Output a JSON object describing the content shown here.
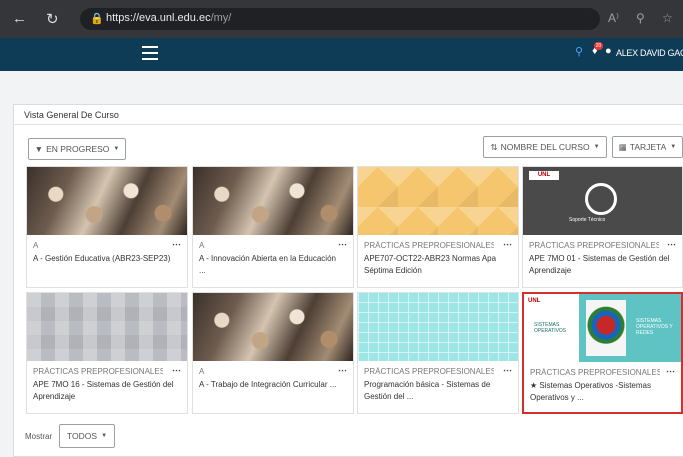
{
  "browser": {
    "url_host": "https://eva.unl.edu.ec",
    "url_path": "/my/",
    "reader_label": "A⁾"
  },
  "header": {
    "username": "ALEX DAVID GAON",
    "notification_count": "20"
  },
  "panel": {
    "title": "Vista General De Curso",
    "filter_label": "EN PROGRESO",
    "sort_label": "NOMBRE DEL CURSO",
    "view_label": "TARJETA"
  },
  "courses": [
    {
      "category": "A",
      "name": "A - Gestión Educativa (ABR23-SEP23)",
      "thumb": "crowd"
    },
    {
      "category": "A",
      "name": "A - Innovación Abierta en la Educación ...",
      "thumb": "crowd"
    },
    {
      "category": "PRÁCTICAS PREPROFESIONALES ...",
      "name": "APE707-OCT22-ABR23 Normas Apa Séptima Edición",
      "thumb": "diamond"
    },
    {
      "category": "PRÁCTICAS PREPROFESIONALES ...",
      "name": "APE 7MO 01 - Sistemas de Gestión del Aprendizaje",
      "thumb": "dark"
    },
    {
      "category": "PRÁCTICAS PREPROFESIONALES ...",
      "name": "APE 7MO 16 - Sistemas de Gestión del Aprendizaje",
      "thumb": "blur"
    },
    {
      "category": "A",
      "name": "A - Trabajo de Integración Curricular ...",
      "thumb": "crowd"
    },
    {
      "category": "PRÁCTICAS PREPROFESIONALES ...",
      "name": "Programación básica - Sistemas de Gestión del ...",
      "thumb": "grid"
    },
    {
      "category": "PRÁCTICAS PREPROFESIONALES ...",
      "name": "Sistemas Operativos -Sistemas Operativos y ...",
      "thumb": "logo",
      "starred": true
    }
  ],
  "card_thumb_texts": {
    "soporte": "Soporte Técnico",
    "unl": "UNL",
    "sistemas": "SISTEMAS OPERATIVOS",
    "banner": "SISTEMAS OPERATIVOS Y REDES"
  },
  "footer": {
    "show_label": "Mostrar",
    "show_value": "TODOS"
  },
  "colors": {
    "nav_bar": "#0e3b56",
    "highlight": "#d0312d"
  }
}
